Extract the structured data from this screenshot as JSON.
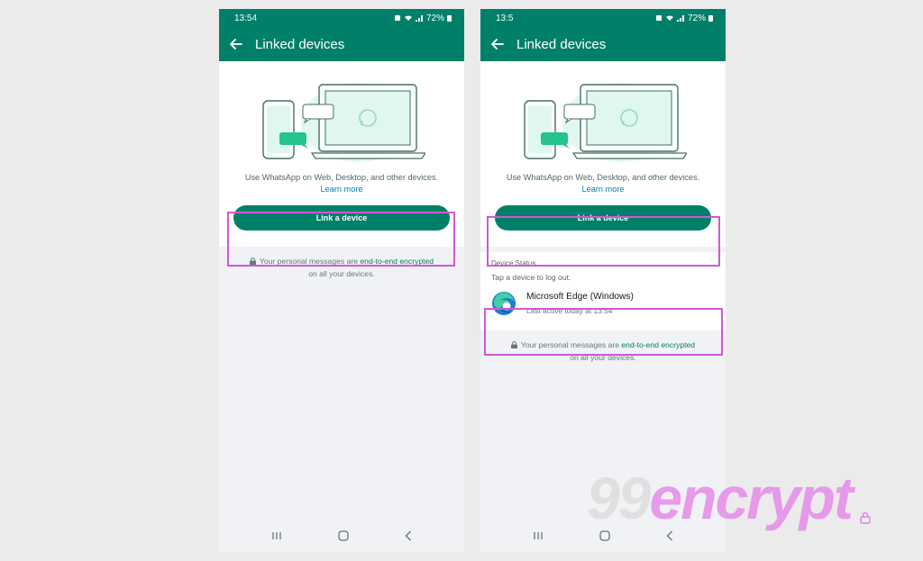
{
  "colors": {
    "brand": "#008069",
    "highlight": "#d257d8",
    "link": "#027eb5"
  },
  "left": {
    "status_time": "13:54",
    "battery": "72%",
    "title": "Linked devices",
    "description": "Use WhatsApp on Web, Desktop, and other devices.",
    "learn_more": "Learn more",
    "link_button": "Link a device",
    "e2e_prefix": "Your personal messages are",
    "e2e_link": "end-to-end encrypted",
    "e2e_suffix": "on all your devices."
  },
  "right": {
    "status_time": "13:5",
    "battery": "72%",
    "title": "Linked devices",
    "description": "Use WhatsApp on Web, Desktop, and other devices.",
    "learn_more": "Learn more",
    "link_button": "Link a device",
    "device_status_title": "Device Status",
    "device_status_hint": "Tap a device to log out.",
    "device": {
      "name": "Microsoft Edge (Windows)",
      "last_active": "Last active today at 13:54"
    },
    "e2e_prefix": "Your personal messages are",
    "e2e_link": "end-to-end encrypted",
    "e2e_suffix": "on all your devices."
  },
  "watermark": {
    "number": "99",
    "text": "encrypt"
  },
  "icons": [
    "back-arrow-icon",
    "whatsapp-logo-icon",
    "lock-icon",
    "edge-browser-icon",
    "recent-apps-icon",
    "home-icon",
    "nav-back-icon",
    "wifi-icon",
    "signal-icon",
    "battery-icon",
    "alarm-icon"
  ]
}
